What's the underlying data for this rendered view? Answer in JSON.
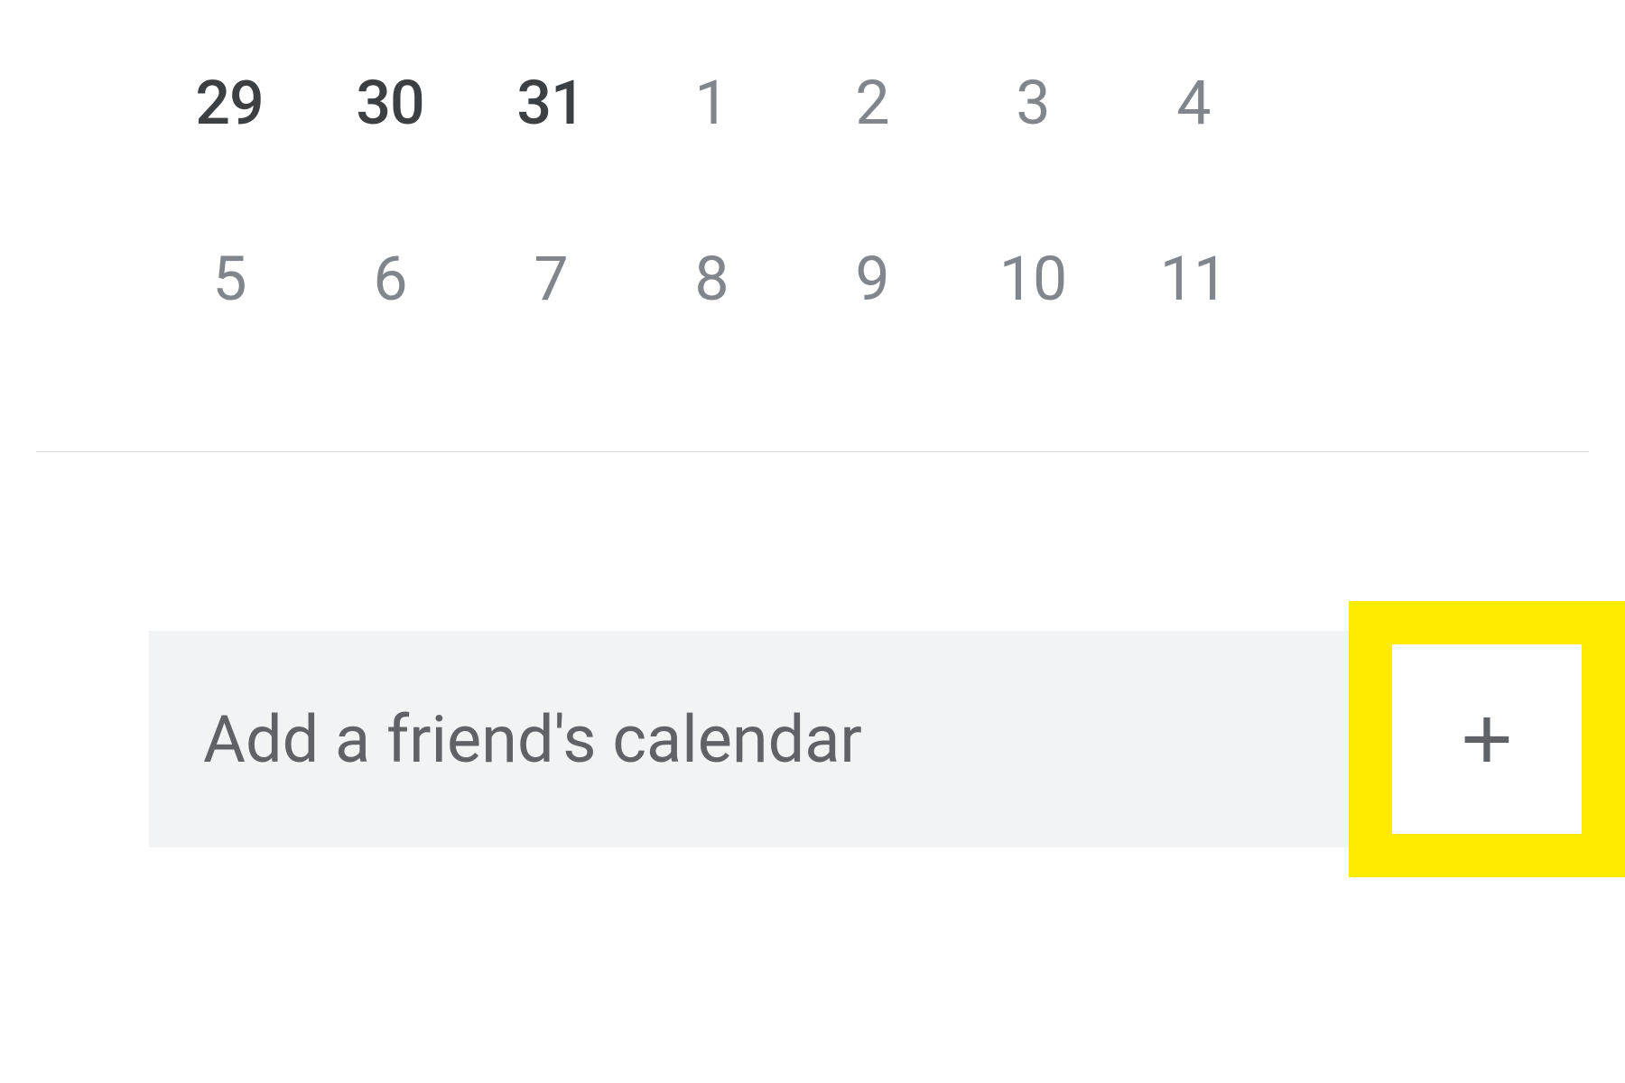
{
  "mini_calendar": {
    "rows": [
      [
        {
          "day": "29",
          "current_month": true
        },
        {
          "day": "30",
          "current_month": true
        },
        {
          "day": "31",
          "current_month": true
        },
        {
          "day": "1",
          "current_month": false
        },
        {
          "day": "2",
          "current_month": false
        },
        {
          "day": "3",
          "current_month": false
        },
        {
          "day": "4",
          "current_month": false
        }
      ],
      [
        {
          "day": "5",
          "current_month": false
        },
        {
          "day": "6",
          "current_month": false
        },
        {
          "day": "7",
          "current_month": false
        },
        {
          "day": "8",
          "current_month": false
        },
        {
          "day": "9",
          "current_month": false
        },
        {
          "day": "10",
          "current_month": false
        },
        {
          "day": "11",
          "current_month": false
        }
      ]
    ]
  },
  "add_calendar": {
    "placeholder": "Add a friend's calendar",
    "plus_label": "+"
  },
  "colors": {
    "highlight": "#ffeb00",
    "text_muted": "#80868b",
    "text_dark": "#3c4043",
    "input_bg": "#f1f3f4"
  }
}
